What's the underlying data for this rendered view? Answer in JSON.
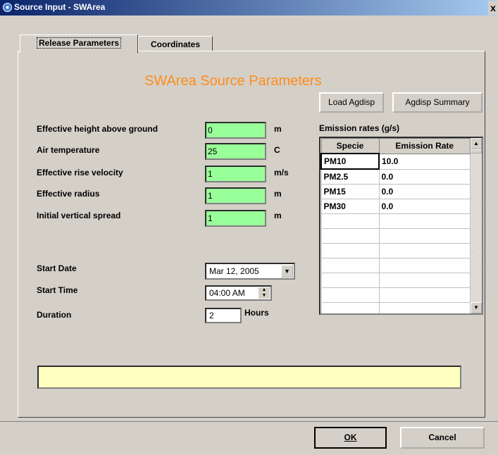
{
  "window": {
    "title": "Source Input - SWArea",
    "close": "x"
  },
  "tabs": [
    {
      "label": "Release Parameters"
    },
    {
      "label": "Coordinates"
    }
  ],
  "header": "SWArea Source Parameters",
  "buttons": {
    "load_agdisp": "Load Agdisp",
    "agdisp_summary": "Agdisp Summary",
    "ok": "OK",
    "cancel": "Cancel"
  },
  "params": [
    {
      "label": "Effective height above ground",
      "value": "0",
      "unit": "m"
    },
    {
      "label": "Air temperature",
      "value": "25",
      "unit": "C"
    },
    {
      "label": "Effective rise velocity",
      "value": "1",
      "unit": "m/s"
    },
    {
      "label": "Effective radius",
      "value": "1",
      "unit": "m"
    },
    {
      "label": "Initial vertical spread",
      "value": "1",
      "unit": "m"
    }
  ],
  "emissions": {
    "title": "Emission rates (g/s)",
    "columns": [
      "Specie",
      "Emission Rate"
    ],
    "rows": [
      [
        "PM10",
        "10.0"
      ],
      [
        "PM2.5",
        "0.0"
      ],
      [
        "PM15",
        "0.0"
      ],
      [
        "PM30",
        "0.0"
      ]
    ]
  },
  "schedule": {
    "start_date_label": "Start Date",
    "start_date": "Mar 12, 2005",
    "start_time_label": "Start Time",
    "start_time": "04:00 AM",
    "duration_label": "Duration",
    "duration": "2",
    "duration_unit": "Hours"
  },
  "status_text": "",
  "colors": {
    "header": "#ff8c1a",
    "input_bg": "#99ff99",
    "status_bg": "#ffffc0",
    "title_gradient_start": "#0a246a"
  }
}
